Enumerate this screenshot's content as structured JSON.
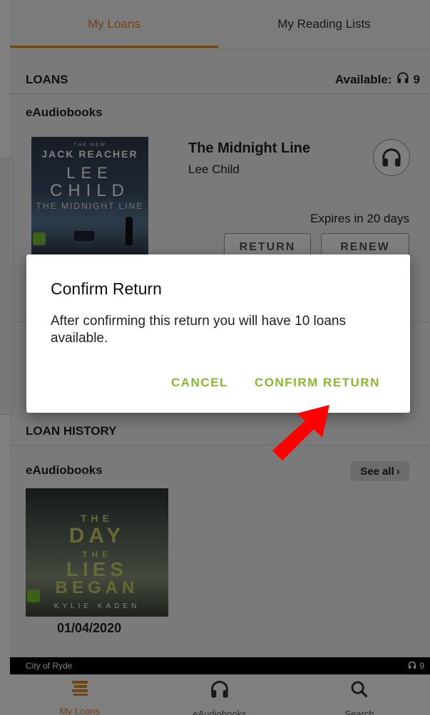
{
  "tabs": {
    "my_loans": "My Loans",
    "my_reading_lists": "My Reading Lists"
  },
  "loans": {
    "header": "LOANS",
    "available_label": "Available:",
    "available_count": "9",
    "subheader": "eAudiobooks",
    "book": {
      "cover": {
        "small": "THE NEW",
        "series": "JACK REACHER",
        "author_first": "LEE",
        "author_last": "CHILD",
        "title": "THE MIDNIGHT LINE"
      },
      "title": "The Midnight Line",
      "author": "Lee Child",
      "expires": "Expires in 20 days",
      "return_label": "RETURN",
      "renew_label": "RENEW"
    }
  },
  "history": {
    "header": "LOAN HISTORY",
    "subheader": "eAudiobooks",
    "see_all": "See all",
    "book": {
      "cover": {
        "the1": "THE",
        "day": "DAY",
        "the2": "THE",
        "lies": "LIES",
        "began": "BEGAN",
        "author": "KYLIE KADEN"
      },
      "date": "01/04/2020"
    }
  },
  "status": {
    "library": "City of Ryde",
    "count": "9"
  },
  "nav": {
    "loans": "My Loans",
    "audiobooks": "eAudiobooks",
    "search": "Search"
  },
  "dialog": {
    "title": "Confirm Return",
    "message": "After confirming this return you will have 10 loans available.",
    "cancel": "CANCEL",
    "confirm": "CONFIRM RETURN"
  },
  "colors": {
    "accent": "#e08a2a",
    "dialog_button": "#8ab733",
    "arrow": "#ff0000"
  }
}
